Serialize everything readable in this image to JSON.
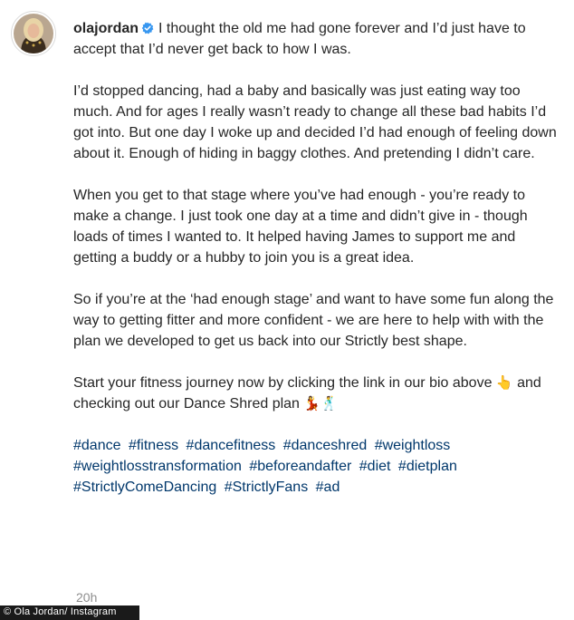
{
  "post": {
    "username": "olajordan",
    "verified_icon": "verified-badge-icon",
    "avatar_icon": "profile-avatar",
    "first_line": "I thought the old me had gone forever and I’d just have to accept that I’d never get back to how I was.",
    "paragraphs": [
      "I’d stopped dancing, had a baby and basically was just eating way too much. And for ages I really wasn’t ready to change all these bad habits I’d got into. But one day I woke up and decided I’d had enough of feeling down about it. Enough of hiding in baggy clothes. And pretending I didn’t care.",
      "When you get to that stage where you’ve had enough - you’re ready to make a change. I just took one day at a time and didn’t give in - though loads of times I wanted to. It helped having James to support me and getting a buddy or a hubby to join you is a great idea.",
      "So if you’re at the ‘had enough stage’ and want to have some fun along the way to getting fitter and more confident - we are here to help with with the plan we developed to get us back into our Strictly best shape."
    ],
    "cta_part1": "Start your fitness journey now by clicking the link in our bio above",
    "cta_emoji1": "👆",
    "cta_part2": "and checking out our Dance Shred plan",
    "cta_emoji2": "💃🕺",
    "hashtags": [
      "#dance",
      "#fitness",
      "#dancefitness",
      "#danceshred",
      "#weightloss",
      "#weightlosstransformation",
      "#beforeandafter",
      "#diet",
      "#dietplan",
      "#StrictlyComeDancing",
      "#StrictlyFans",
      "#ad"
    ],
    "timestamp": "20h"
  },
  "credit": "© Ola Jordan/ Instagram",
  "colors": {
    "text": "#262626",
    "hashtag": "#00376b",
    "timestamp": "#8e8e8e",
    "verified": "#3897f0",
    "credit_bg": "#1a1a1a"
  }
}
